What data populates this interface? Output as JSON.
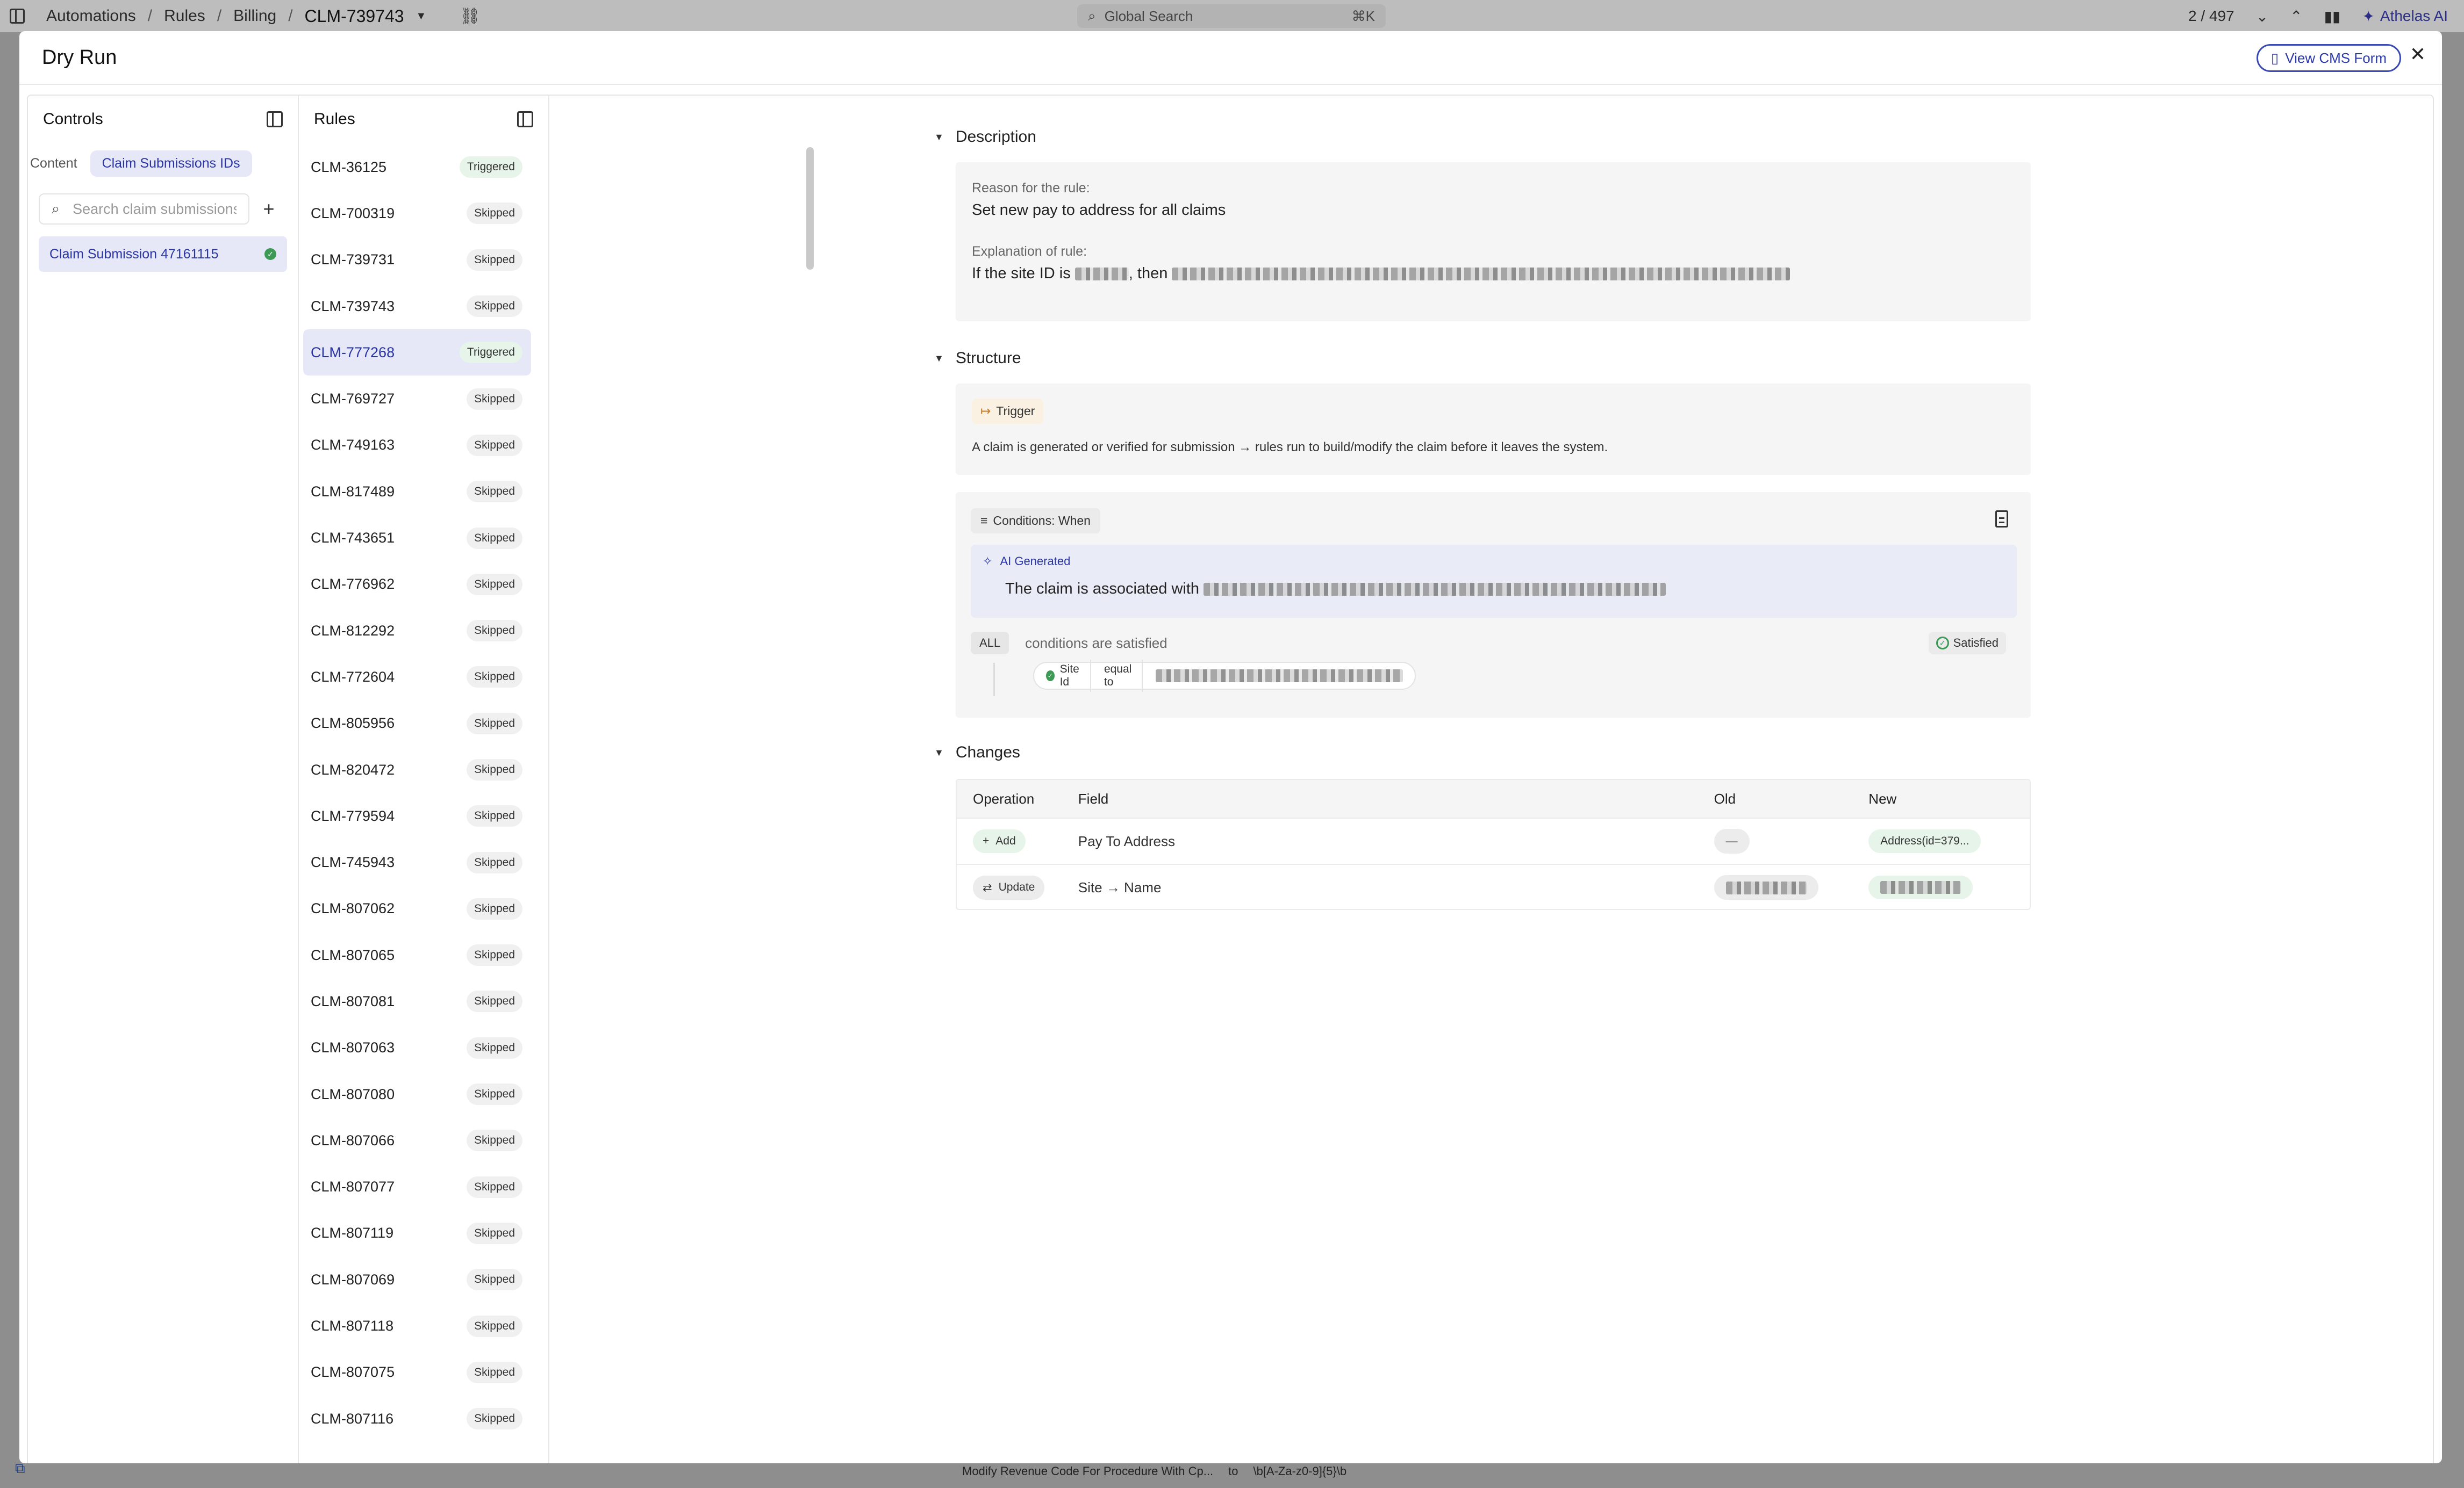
{
  "topbar": {
    "breadcrumbs": [
      "Automations",
      "Rules",
      "Billing"
    ],
    "current": "CLM-739743",
    "search_placeholder": "Global Search",
    "search_shortcut": "⌘K",
    "pager": "2 / 497",
    "brand": "Athelas AI"
  },
  "modal": {
    "title": "Dry Run",
    "cms_button": "View CMS Form"
  },
  "controls": {
    "title": "Controls",
    "tabs": [
      "Content",
      "Claim Submissions IDs"
    ],
    "active_tab": "Claim Submissions IDs",
    "search_placeholder": "Search claim submissions",
    "claim_item": "Claim Submission 47161115"
  },
  "rules": {
    "title": "Rules",
    "items": [
      {
        "id": "CLM-36125",
        "status": "Triggered"
      },
      {
        "id": "CLM-700319",
        "status": "Skipped"
      },
      {
        "id": "CLM-739731",
        "status": "Skipped"
      },
      {
        "id": "CLM-739743",
        "status": "Skipped"
      },
      {
        "id": "CLM-777268",
        "status": "Triggered"
      },
      {
        "id": "CLM-769727",
        "status": "Skipped"
      },
      {
        "id": "CLM-749163",
        "status": "Skipped"
      },
      {
        "id": "CLM-817489",
        "status": "Skipped"
      },
      {
        "id": "CLM-743651",
        "status": "Skipped"
      },
      {
        "id": "CLM-776962",
        "status": "Skipped"
      },
      {
        "id": "CLM-812292",
        "status": "Skipped"
      },
      {
        "id": "CLM-772604",
        "status": "Skipped"
      },
      {
        "id": "CLM-805956",
        "status": "Skipped"
      },
      {
        "id": "CLM-820472",
        "status": "Skipped"
      },
      {
        "id": "CLM-779594",
        "status": "Skipped"
      },
      {
        "id": "CLM-745943",
        "status": "Skipped"
      },
      {
        "id": "CLM-807062",
        "status": "Skipped"
      },
      {
        "id": "CLM-807065",
        "status": "Skipped"
      },
      {
        "id": "CLM-807081",
        "status": "Skipped"
      },
      {
        "id": "CLM-807063",
        "status": "Skipped"
      },
      {
        "id": "CLM-807080",
        "status": "Skipped"
      },
      {
        "id": "CLM-807066",
        "status": "Skipped"
      },
      {
        "id": "CLM-807077",
        "status": "Skipped"
      },
      {
        "id": "CLM-807119",
        "status": "Skipped"
      },
      {
        "id": "CLM-807069",
        "status": "Skipped"
      },
      {
        "id": "CLM-807118",
        "status": "Skipped"
      },
      {
        "id": "CLM-807075",
        "status": "Skipped"
      },
      {
        "id": "CLM-807116",
        "status": "Skipped"
      }
    ],
    "selected": "CLM-777268"
  },
  "description": {
    "section": "Description",
    "reason_label": "Reason for the rule:",
    "reason_text": "Set new pay to address for all claims",
    "explanation_label": "Explanation of rule:",
    "explanation_prefix": "If the site ID is",
    "explanation_mid": ", then"
  },
  "structure": {
    "section": "Structure",
    "trigger_chip": "Trigger",
    "trigger_text": "A claim is generated or verified for submission → rules run to build/modify the claim before it leaves the system.",
    "conditions_chip": "Conditions: When",
    "ai_label": "AI Generated",
    "ai_text": "The claim is associated with",
    "all_chip": "ALL",
    "all_text": "conditions are satisfied",
    "satisfied": "Satisfied",
    "cond_field": "Site Id",
    "cond_op": "equal to"
  },
  "changes": {
    "section": "Changes",
    "headers": [
      "Operation",
      "Field",
      "Old",
      "New"
    ],
    "rows": [
      {
        "op": "Add",
        "field": "Pay To Address",
        "old": "—",
        "new": "Address(id=379..."
      },
      {
        "op": "Update",
        "field": "Site → Name",
        "old": "",
        "new": ""
      }
    ]
  },
  "bottombar": {
    "rule": "Modify Revenue Code For Procedure With Cp...",
    "to": "to",
    "regex": "\\b[A-Za-z0-9]{5}\\b"
  },
  "colors": {
    "accent": "#2a36a4",
    "selected_bg": "#e6e8f7",
    "success": "#3d9a55"
  }
}
